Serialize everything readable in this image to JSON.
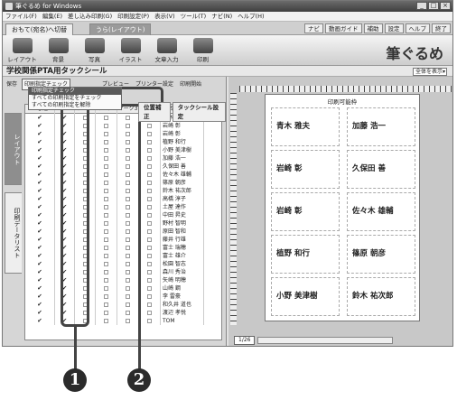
{
  "window": {
    "title": "筆ぐるめ for Windows",
    "buttons": [
      "_",
      "□",
      "×"
    ]
  },
  "menu": [
    "ファイル(F)",
    "編集(E)",
    "差し込み印刷(G)",
    "印刷設定(P)",
    "表示(V)",
    "ツール(T)",
    "ナビ(N)",
    "ヘルプ(H)"
  ],
  "tabs": {
    "start": "おもて(宛名)へ切替",
    "layout": "うら(レイアウト)",
    "right": [
      "ナビ",
      "動画ガイド",
      "補助",
      "設定",
      "ヘルプ",
      "終了"
    ]
  },
  "tools": [
    "レイアウト",
    "背景",
    "写真",
    "イラスト",
    "文章入力",
    "印刷"
  ],
  "brand": "筆ぐるめ",
  "doc_title": "学校関係PTA用タックシール",
  "zoom": "全体を表示",
  "subtoolbar": [
    "保存",
    "印刷指定チェック",
    "プレビュー",
    "プリンター設定",
    "印刷開始"
  ],
  "dropdown": [
    "印刷指定チェック",
    "すべての印刷指定をチェック",
    "すべての印刷指定を解除"
  ],
  "grid_tabs": [
    "位置補正",
    "タックシール設定"
  ],
  "side_tabs": [
    "レイアウト",
    "印刷データリスト"
  ],
  "columns": [
    "差し込",
    "シール",
    "マーク1",
    "マーク2",
    "マーク3",
    "マーク4",
    "氏名"
  ],
  "names": [
    "青木 雅夫",
    "岩崎 彰",
    "岩崎 彰",
    "植野 和行",
    "小野 美津樹",
    "加藤 浩一",
    "久保田 善",
    "佐々木 雄輔",
    "篠原 朝彦",
    "鈴木 祐次郎",
    "高橋 淳子",
    "土屋 達作",
    "中田 昇史",
    "野村 智明",
    "原田 智和",
    "藤井 行雄",
    "富士 瑞穂",
    "富士 雄介",
    "松園 智志",
    "森川 秀治",
    "矢崎 明穂",
    "山崎 鋼",
    "李 雷豪",
    "和久井 道也",
    "渡辺 孝悦",
    "TOM"
  ],
  "sheet": {
    "title": "印刷可能枠",
    "labels": [
      "青木 雅夫",
      "加藤 浩一",
      "岩崎 彰",
      "久保田 善",
      "岩崎 彰",
      "佐々木 雄輔",
      "植野 和行",
      "篠原 朝彦",
      "小野 美津樹",
      "鈴木 祐次郎"
    ]
  },
  "page": "1/26",
  "callouts": [
    "1",
    "2"
  ]
}
